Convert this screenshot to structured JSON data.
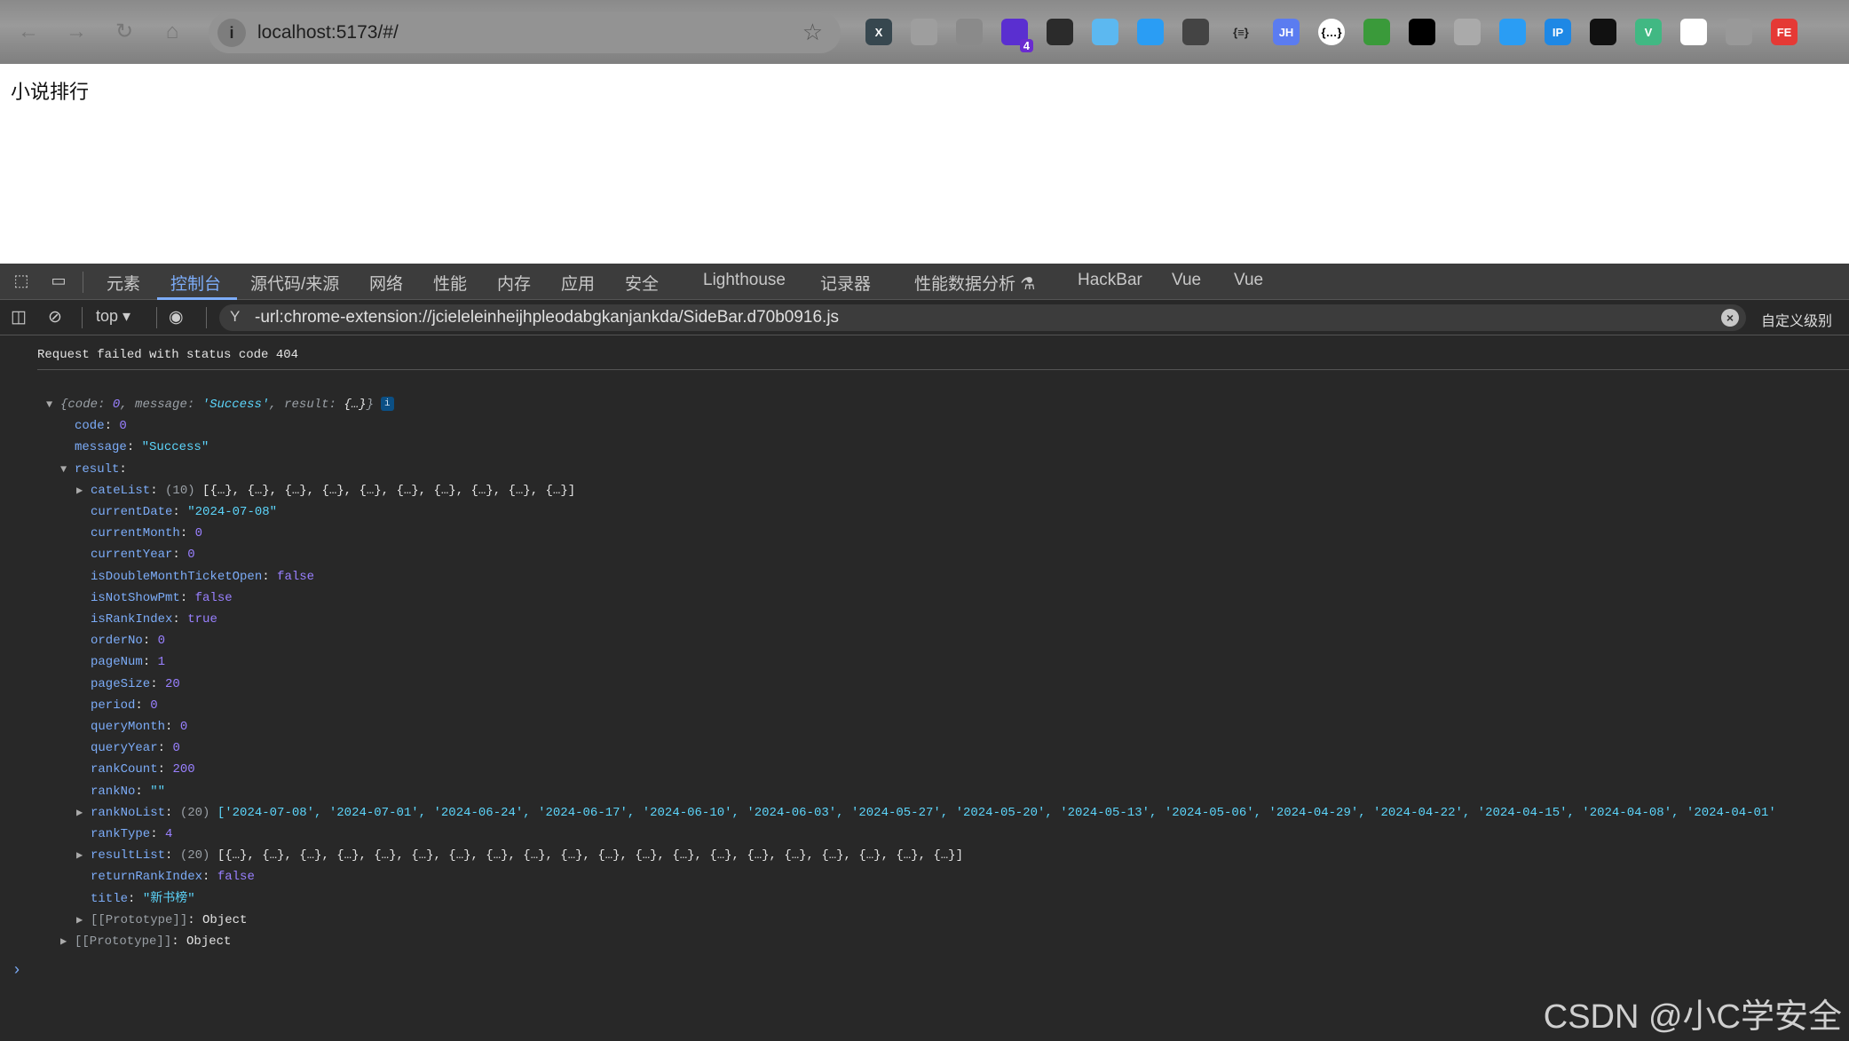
{
  "browser": {
    "url": "localhost:5173/#/",
    "extensions": [
      "x-ext-icon",
      "camera-ext-icon",
      "robot-ext-icon",
      "purple-ext-icon",
      "circle-ext-icon",
      "cloud-ext-icon",
      "pin-ext-icon",
      "hat-ext-icon",
      "braces-ext-icon",
      "jh-ext-icon",
      "json-ext-icon",
      "globe-ext-icon",
      "ring-ext-icon",
      "cmd-ext-icon",
      "spy-ext-icon",
      "ip-ext-icon",
      "hacker-ext-icon",
      "vue-ext-icon",
      "a-ext-icon",
      "satellite-ext-icon",
      "fe-ext-icon"
    ],
    "ext_badge": "4",
    "ext_labels": {
      "x": "X",
      "jh": "JH",
      "ip": "IP",
      "v": "V",
      "fe": "FE",
      "braces": "{≡}",
      "json": "{…}"
    }
  },
  "page": {
    "title": "小说排行"
  },
  "devtools": {
    "tabs": [
      "元素",
      "控制台",
      "源代码/来源",
      "网络",
      "性能",
      "内存",
      "应用",
      "安全",
      "Lighthouse",
      "记录器",
      "性能数据分析 ⚗",
      "HackBar",
      "Vue",
      "Vue"
    ],
    "active_tab": "控制台",
    "context": "top",
    "filter": "-url:chrome-extension://jcieleleinheijhpleodabgkanjankda/SideBar.d70b0916.js",
    "custom_levels": "自定义级别"
  },
  "console": {
    "error": "Request failed with status code 404",
    "summary": {
      "code": "0",
      "message": "'Success'",
      "result": "{…}"
    },
    "info_badge": "i",
    "top": [
      {
        "key": "code",
        "value": "0",
        "type": "n"
      },
      {
        "key": "message",
        "value": "\"Success\"",
        "type": "s"
      }
    ],
    "result_key": "result",
    "result": [
      {
        "key": "cateList",
        "count": "(10)",
        "value": "[{…}, {…}, {…}, {…}, {…}, {…}, {…}, {…}, {…}, {…}]",
        "type": "o",
        "expand": true
      },
      {
        "key": "currentDate",
        "value": "\"2024-07-08\"",
        "type": "s"
      },
      {
        "key": "currentMonth",
        "value": "0",
        "type": "n"
      },
      {
        "key": "currentYear",
        "value": "0",
        "type": "n"
      },
      {
        "key": "isDoubleMonthTicketOpen",
        "value": "false",
        "type": "n"
      },
      {
        "key": "isNotShowPmt",
        "value": "false",
        "type": "n"
      },
      {
        "key": "isRankIndex",
        "value": "true",
        "type": "n"
      },
      {
        "key": "orderNo",
        "value": "0",
        "type": "n"
      },
      {
        "key": "pageNum",
        "value": "1",
        "type": "n"
      },
      {
        "key": "pageSize",
        "value": "20",
        "type": "n"
      },
      {
        "key": "period",
        "value": "0",
        "type": "n"
      },
      {
        "key": "queryMonth",
        "value": "0",
        "type": "n"
      },
      {
        "key": "queryYear",
        "value": "0",
        "type": "n"
      },
      {
        "key": "rankCount",
        "value": "200",
        "type": "n"
      },
      {
        "key": "rankNo",
        "value": "\"\"",
        "type": "s"
      },
      {
        "key": "rankNoList",
        "count": "(20)",
        "value": "['2024-07-08', '2024-07-01', '2024-06-24', '2024-06-17', '2024-06-10', '2024-06-03', '2024-05-27', '2024-05-20', '2024-05-13', '2024-05-06', '2024-04-29', '2024-04-22', '2024-04-15', '2024-04-08', '2024-04-01'",
        "type": "s",
        "expand": true
      },
      {
        "key": "rankType",
        "value": "4",
        "type": "n"
      },
      {
        "key": "resultList",
        "count": "(20)",
        "value": "[{…}, {…}, {…}, {…}, {…}, {…}, {…}, {…}, {…}, {…}, {…}, {…}, {…}, {…}, {…}, {…}, {…}, {…}, {…}, {…}]",
        "type": "o",
        "expand": true
      },
      {
        "key": "returnRankIndex",
        "value": "false",
        "type": "n"
      },
      {
        "key": "title",
        "value": "\"新书榜\"",
        "type": "s"
      },
      {
        "key": "[[Prototype]]",
        "value": "Object",
        "type": "o",
        "expand": true,
        "proto": true
      }
    ],
    "outer_proto": {
      "key": "[[Prototype]]",
      "value": "Object"
    }
  },
  "watermark": "CSDN @小C学安全",
  "colors": {
    "accent": "#7cacf8",
    "string": "#5cd5fb",
    "number": "#9980ff",
    "background": "#282828"
  }
}
